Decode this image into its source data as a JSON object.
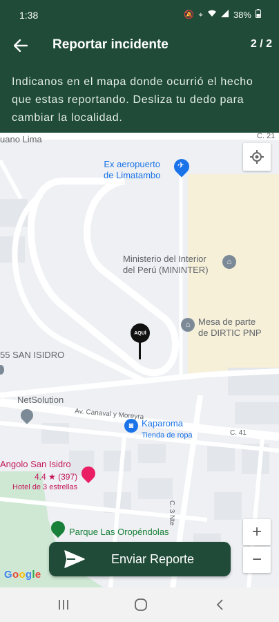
{
  "status_bar": {
    "time": "1:38",
    "battery": "38%",
    "icons": [
      "mute-icon",
      "location-icon",
      "wifi-icon",
      "signal-icon",
      "battery-icon"
    ]
  },
  "app_bar": {
    "title": "Reportar incidente",
    "step": "2 / 2",
    "back_icon": "arrow-left-icon"
  },
  "instructions": "Indicanos en el mapa donde ocurrió el hecho que estas reportando. Desliza tu dedo para cambiar la localidad.",
  "map": {
    "street_labels": {
      "top_left": "uano Lima",
      "top_right": "C. 21",
      "san_isidro": "55 SAN ISIDRO",
      "av_canaval": "Av. Canaval y Moreyra",
      "c41": "C. 41",
      "c3": "C. 3 Nte"
    },
    "pois": {
      "airport": "Ex aeropuerto\nde Limatambo",
      "ministerio": "Ministerio del Interior\ndel Perú (MININTER)",
      "mesa": "Mesa de parte\nde DIRTIC PNP",
      "netsolution": "NetSolution",
      "kaparoma_name": "Kaparoma",
      "kaparoma_sub": "Tienda de ropa",
      "angolo_name": "Angolo San Isidro",
      "angolo_rating": "4.4 ★ (397)",
      "angolo_sub": "Hotel de 3 estrellas",
      "parque": "Parque Las Oropéndolas"
    },
    "marker_text": "AQUÍ",
    "zoom_in": "+",
    "zoom_out": "−",
    "google": "Google"
  },
  "send_button": {
    "label": "Enviar Reporte",
    "icon": "send-icon"
  },
  "nav_bar": {
    "recents": "|||",
    "home": "○",
    "back": "‹"
  },
  "colors": {
    "primary": "#1f4b38",
    "map_bg": "#eef0f3",
    "poi_blue": "#1a73e8",
    "poi_pink": "#c2185b",
    "poi_green": "#188038"
  }
}
